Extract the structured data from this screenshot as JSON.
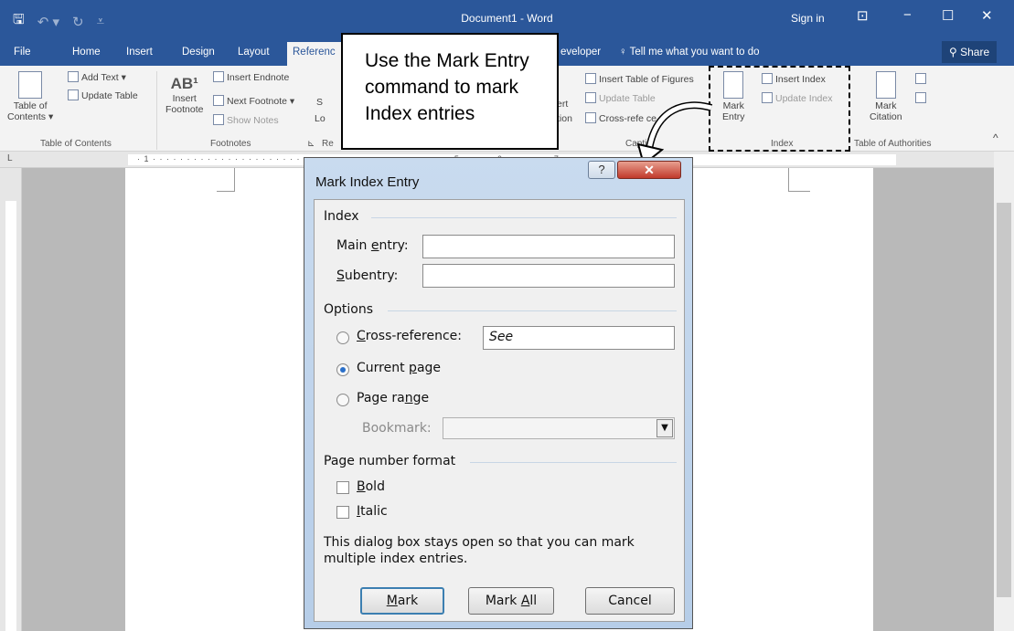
{
  "titlebar": {
    "title": "Document1 - Word",
    "signin": "Sign in",
    "save_icon": "save-icon",
    "minimize": "−",
    "maximize": "☐",
    "close": "✕",
    "ribbon_display": "⊡"
  },
  "tabs": {
    "file": "File",
    "home": "Home",
    "insert": "Insert",
    "design": "Design",
    "layout": "Layout",
    "references": "Referenc",
    "developer": "eveloper",
    "tell_me": "Tell me what you want to do",
    "share": "Share"
  },
  "ribbon": {
    "toc": {
      "btn1": "Table of",
      "btn2": "Contents ▾",
      "add_text": "Add Text ▾",
      "update_table": "Update Table",
      "group": "Table of Contents"
    },
    "footnotes": {
      "insert_footnote_glyph": "AB¹",
      "insert1": "Insert",
      "insert2": "Footnote",
      "insert_endnote": "Insert Endnote",
      "next_footnote": "Next Footnote ▾",
      "show_notes": "Show Notes",
      "group": "Footnotes",
      "launcher": "⊾"
    },
    "research": {
      "s": "S",
      "lo": "Lo",
      "re": "Re"
    },
    "captions": {
      "ert": "ert",
      "tion": "tion",
      "insert_tof": "Insert Table of Figures",
      "update_table": "Update Table",
      "cross_ref": "Cross-refe  ce",
      "group": "Captio"
    },
    "index": {
      "mark1": "Mark",
      "mark2": "Entry",
      "insert_index": "Insert Index",
      "update_index": "Update Index",
      "group": "Index"
    },
    "toa": {
      "mark1": "Mark",
      "mark2": "Citation",
      "group": "Table of Authorities"
    },
    "collapse": "^"
  },
  "ruler": {
    "numbers": "· 1 · · · · · · · · · · · · · · · · · · · · · · · · · · · · · · · · · · · · · · · · · · · · 5 · · · · · 6 · · · · · · · 7",
    "tab_marker": "L"
  },
  "callout": {
    "lines": [
      "Use the Mark Entry",
      "command to mark",
      "Index entries"
    ]
  },
  "dialog": {
    "title": "Mark Index Entry",
    "help": "?",
    "close": "✕",
    "index_section": "Index",
    "main_entry_label_a": "Main ",
    "main_entry_label_u": "e",
    "main_entry_label_b": "ntry:",
    "main_entry_value": "",
    "subentry_label_u": "S",
    "subentry_label_b": "ubentry:",
    "subentry_value": "",
    "options_section": "Options",
    "cross_ref_u": "C",
    "cross_ref_b": "ross-reference:",
    "cross_ref_value": "See",
    "current_page_a": "Current ",
    "current_page_u": "p",
    "current_page_b": "age",
    "page_range_a": "Page ra",
    "page_range_u": "n",
    "page_range_b": "ge",
    "bookmark_label": "Bookmark:",
    "bookmark_value": "",
    "format_section": "Page number format",
    "bold_u": "B",
    "bold_b": "old",
    "italic_u": "I",
    "italic_b": "talic",
    "note": "This dialog box stays open so that you can mark multiple index entries.",
    "mark_u": "M",
    "mark_b": "ark",
    "markall_a": "Mark ",
    "markall_u": "A",
    "markall_b": "ll",
    "cancel": "Cancel",
    "selected_option": "Current page"
  }
}
